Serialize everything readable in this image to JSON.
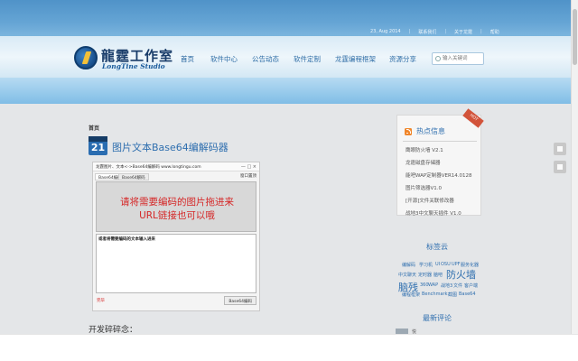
{
  "header": {
    "topbar": {
      "date": "23, Aug 2014",
      "links": [
        "联系我们",
        "关于龙霆",
        "帮助"
      ]
    },
    "logo": {
      "name_cn": "龍霆工作室",
      "name_en": "LongTine Studio",
      "icon": "lightning-emblem-icon"
    },
    "nav": [
      {
        "label": "首页",
        "active": true
      },
      {
        "label": "软件中心",
        "active": false
      },
      {
        "label": "公告动态",
        "active": false
      },
      {
        "label": "软件定制",
        "active": false
      },
      {
        "label": "龙霆编程框架",
        "active": false
      },
      {
        "label": "资源分享",
        "active": false
      }
    ],
    "search": {
      "placeholder": "输入关键词",
      "icon": "search-icon"
    }
  },
  "content": {
    "breadcrumb": "首页",
    "post": {
      "day": "21",
      "title": "图片文本Base64编解码器"
    },
    "app_screenshot": {
      "window_title": "龙霆图片、文本<->Base64编解码 www.longtingu.com",
      "window_buttons": "—  □  ×",
      "tabs": [
        {
          "label": "Base64编码",
          "active": true
        },
        {
          "label": "Base64解码",
          "active": false
        }
      ],
      "pin_label": "窗口置顶",
      "drop_text_line1": "请将需要编码的图片拖进来",
      "drop_text_line2": "URL链接也可以哦",
      "output_hint": "或者将需要编码的文本输入进来",
      "status_text": "完毕",
      "encode_button": "Base64编码"
    },
    "section_title": "开发碎碎念："
  },
  "sidebar": {
    "hot": {
      "ribbon": "HOT",
      "title": "热点信息",
      "items": [
        "鹰眼防火墙 V2.1",
        "龙霆磁盘存储器",
        "能吧WAP定制器VER14.0128",
        "图片筛选器V1.0",
        "[开源]文件关联修改器",
        "战地3中文聊天插件 V1.0"
      ]
    },
    "tags": {
      "title": "标签云",
      "items": [
        {
          "label": "编解码"
        },
        {
          "label": "学习机"
        },
        {
          "label": "UI"
        },
        {
          "label": "OSU"
        },
        {
          "label": "UPF"
        },
        {
          "label": "服务化器"
        },
        {
          "label": "中文聊天"
        },
        {
          "label": "定时器"
        },
        {
          "label": "脑吧"
        },
        {
          "label": "防火墙"
        },
        {
          "label": "脑残"
        },
        {
          "label": "360"
        },
        {
          "label": "WAP"
        },
        {
          "label": "战地3"
        },
        {
          "label": "文件"
        },
        {
          "label": "客户端"
        },
        {
          "label": "编程框架"
        },
        {
          "label": "Benchmark"
        },
        {
          "label": "截图"
        },
        {
          "label": "Base64"
        }
      ]
    },
    "comments": {
      "title": "最新评论",
      "first_author": "悦"
    }
  },
  "colors": {
    "accent": "#2f6faf",
    "header_blue": "#4b8fc6",
    "drop_text": "#d52626"
  }
}
